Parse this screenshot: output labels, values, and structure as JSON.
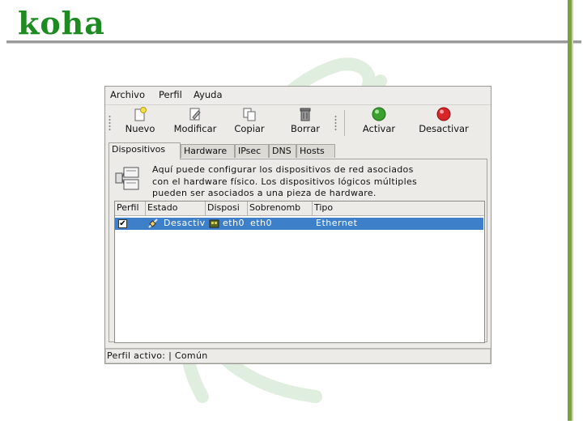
{
  "slide": {
    "title": "koha"
  },
  "menubar": {
    "items": [
      "Archivo",
      "Perfil",
      "Ayuda"
    ]
  },
  "toolbar": {
    "nuevo": "Nuevo",
    "modificar": "Modificar",
    "copiar": "Copiar",
    "borrar": "Borrar",
    "activar": "Activar",
    "desactivar": "Desactivar"
  },
  "tabs": [
    "Dispositivos",
    "Hardware",
    "IPsec",
    "DNS",
    "Hosts"
  ],
  "panel": {
    "info_line1": "Aquí puede configurar los dispositivos de red asociados",
    "info_line2": "con el hardware físico. Los dispositivos lógicos múltiples",
    "info_line3": "pueden ser asociados a una pieza de hardware."
  },
  "table": {
    "columns": [
      "Perfil",
      "Estado",
      "Disposi",
      "Sobrenomb",
      "Tipo"
    ],
    "rows": [
      {
        "profile_checked": true,
        "estado": "Desactiv",
        "dispositivo": "eth0",
        "sobrenombre": "eth0",
        "tipo": "Ethernet"
      }
    ]
  },
  "statusbar": {
    "text": "Perfil activo: | Común"
  },
  "colors": {
    "title_green": "#1d8a22",
    "selection_blue": "#3d7fc9",
    "activate_green": "#3aa12e",
    "deactivate_red": "#d6262a"
  }
}
